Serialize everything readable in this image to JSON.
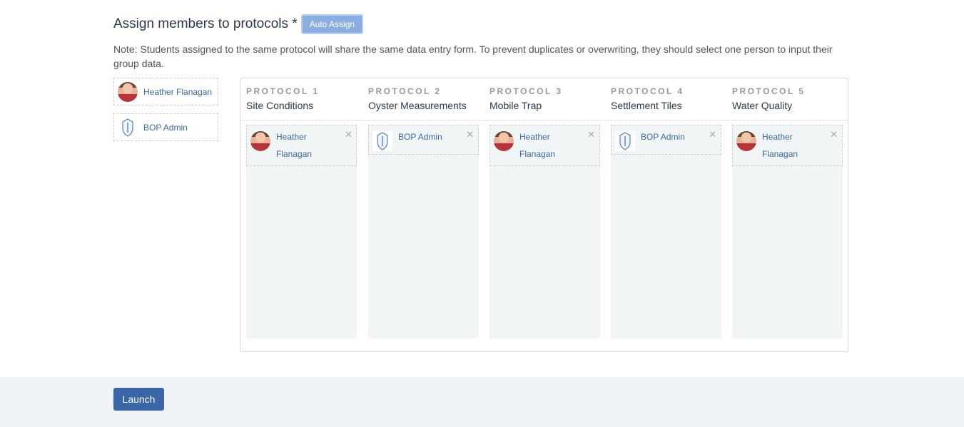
{
  "header": {
    "title": "Assign members to protocols *",
    "auto_assign_label": "Auto Assign"
  },
  "note": "Note: Students assigned to the same protocol will share the same data entry form. To prevent duplicates or overwriting, they should select one person to input their group data.",
  "members": [
    {
      "name": "Heather Flanagan",
      "avatar": "person-avatar"
    },
    {
      "name": "BOP Admin",
      "avatar": "shield-icon"
    }
  ],
  "protocols": [
    {
      "label": "PROTOCOL 1",
      "name": "Site Conditions",
      "assigned": {
        "name": "Heather Flanagan",
        "avatar": "person-avatar"
      }
    },
    {
      "label": "PROTOCOL 2",
      "name": "Oyster Measurements",
      "assigned": {
        "name": "BOP Admin",
        "avatar": "shield-icon"
      }
    },
    {
      "label": "PROTOCOL 3",
      "name": "Mobile Trap",
      "assigned": {
        "name": "Heather Flanagan",
        "avatar": "person-avatar"
      }
    },
    {
      "label": "PROTOCOL 4",
      "name": "Settlement Tiles",
      "assigned": {
        "name": "BOP Admin",
        "avatar": "shield-icon"
      }
    },
    {
      "label": "PROTOCOL 5",
      "name": "Water Quality",
      "assigned": {
        "name": "Heather Flanagan",
        "avatar": "person-avatar"
      }
    }
  ],
  "remove_glyph": "✕",
  "footer": {
    "launch_label": "Launch"
  },
  "colors": {
    "primary": "#3b67a8",
    "auto_assign": "#8aaee0",
    "link": "#3c6aa6",
    "column_bg": "#f2f5f6",
    "footer_bg": "#eff3f5"
  }
}
